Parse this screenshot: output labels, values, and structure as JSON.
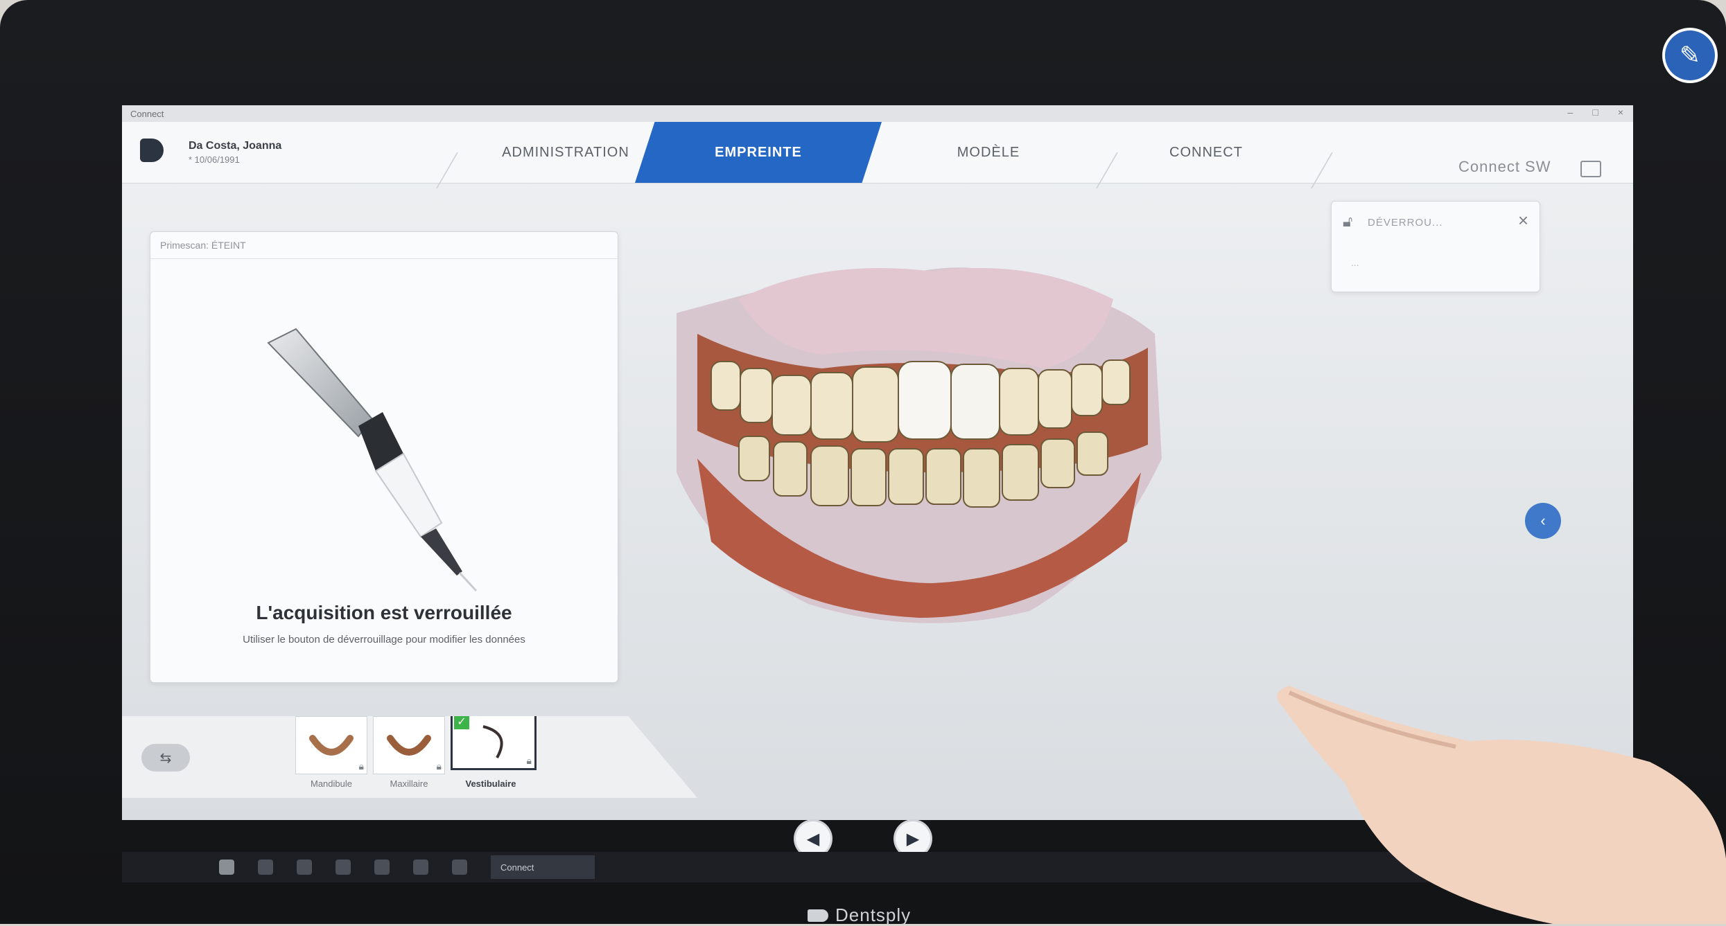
{
  "window": {
    "title": "Connect"
  },
  "header": {
    "patient_name": "Da Costa, Joanna",
    "patient_dob": "* 10/06/1991",
    "tabs": [
      {
        "label": "ADMINISTRATION",
        "active": false
      },
      {
        "label": "EMPREINTE",
        "active": true
      },
      {
        "label": "MODÈLE",
        "active": false
      },
      {
        "label": "CONNECT",
        "active": false
      }
    ],
    "right_label": "Connect SW"
  },
  "left_panel": {
    "header": "Primescan: ÉTEINT",
    "lock_title": "L'acquisition est verrouillée",
    "lock_subtitle": "Utiliser le bouton de déverrouillage pour modifier les données"
  },
  "unlock_card": {
    "label": "DÉVERROU...",
    "sub": "..."
  },
  "scan_strip": {
    "items": [
      {
        "label": "Mandibule",
        "locked": true,
        "active": false
      },
      {
        "label": "Maxillaire",
        "locked": true,
        "active": false
      },
      {
        "label": "Vestibulaire",
        "locked": true,
        "active": true,
        "checked": true
      }
    ]
  },
  "taskbar": {
    "task_label": "Connect"
  },
  "bezel": {
    "brand": "Dentsply"
  },
  "colors": {
    "accent": "#2467c4",
    "check": "#3cb44a"
  }
}
